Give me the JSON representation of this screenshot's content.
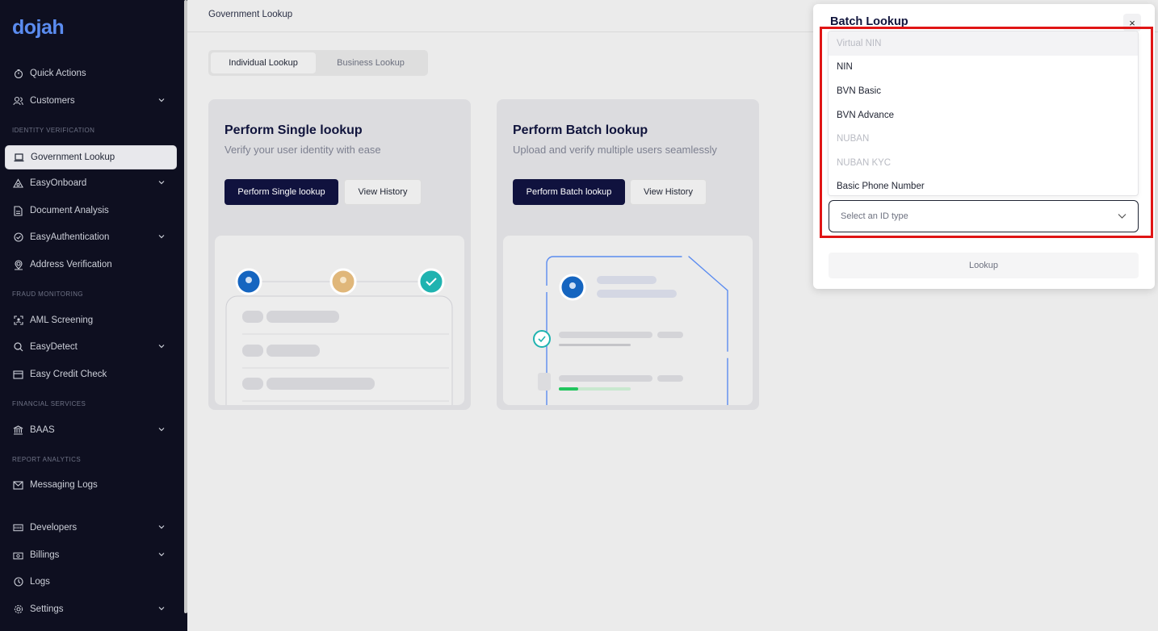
{
  "brand": {
    "logo": "dojah"
  },
  "sidebar": {
    "items": [
      {
        "label": "Quick Actions",
        "icon": "timer-icon",
        "chevron": false
      },
      {
        "label": "Customers",
        "icon": "users-icon",
        "chevron": true
      },
      {
        "label": "Government Lookup",
        "icon": "laptop-icon",
        "chevron": false,
        "active": true
      },
      {
        "label": "EasyOnboard",
        "icon": "onboard-icon",
        "chevron": true
      },
      {
        "label": "Document Analysis",
        "icon": "document-icon",
        "chevron": false
      },
      {
        "label": "EasyAuthentication",
        "icon": "check-circle-icon",
        "chevron": true
      },
      {
        "label": "Address Verification",
        "icon": "location-icon",
        "chevron": false
      },
      {
        "label": "AML Screening",
        "icon": "scan-face-icon",
        "chevron": false
      },
      {
        "label": "EasyDetect",
        "icon": "search-icon",
        "chevron": true
      },
      {
        "label": "Easy Credit Check",
        "icon": "credit-card-icon",
        "chevron": false
      },
      {
        "label": "BAAS",
        "icon": "bank-icon",
        "chevron": true
      },
      {
        "label": "Messaging Logs",
        "icon": "mail-icon",
        "chevron": false
      },
      {
        "label": "Developers",
        "icon": "dev-icon",
        "chevron": true
      },
      {
        "label": "Billings",
        "icon": "billing-icon",
        "chevron": true
      },
      {
        "label": "Logs",
        "icon": "logs-icon",
        "chevron": false
      },
      {
        "label": "Settings",
        "icon": "gear-icon",
        "chevron": true
      }
    ],
    "sections": {
      "identity": "IDENTITY VERIFICATION",
      "fraud": "FRAUD MONITORING",
      "financial": "FINANCIAL SERVICES",
      "report": "REPORT ANALYTICS"
    }
  },
  "header": {
    "title": "Government Lookup"
  },
  "tabs": {
    "individual": "Individual Lookup",
    "business": "Business Lookup"
  },
  "cards": {
    "single": {
      "title": "Perform Single lookup",
      "subtitle": "Verify your user identity with ease",
      "primary": "Perform Single lookup",
      "secondary": "View History"
    },
    "batch": {
      "title": "Perform Batch lookup",
      "subtitle": "Upload and verify multiple users seamlessly",
      "primary": "Perform Batch lookup",
      "secondary": "View History"
    }
  },
  "modal": {
    "title": "Batch Lookup",
    "close": "×",
    "options": [
      {
        "label": "Virtual NIN",
        "disabled": true
      },
      {
        "label": "NIN",
        "disabled": false
      },
      {
        "label": "BVN Basic",
        "disabled": false
      },
      {
        "label": "BVN Advance",
        "disabled": false
      },
      {
        "label": "NUBAN",
        "disabled": true
      },
      {
        "label": "NUBAN KYC",
        "disabled": true
      },
      {
        "label": "Basic Phone Number",
        "disabled": false
      }
    ],
    "select_placeholder": "Select an ID type",
    "lookup": "Lookup"
  },
  "colors": {
    "sidebar_bg": "#0e0f20",
    "primary": "#10123e",
    "highlight": "#e01515",
    "accent_blue": "#1565c0"
  }
}
